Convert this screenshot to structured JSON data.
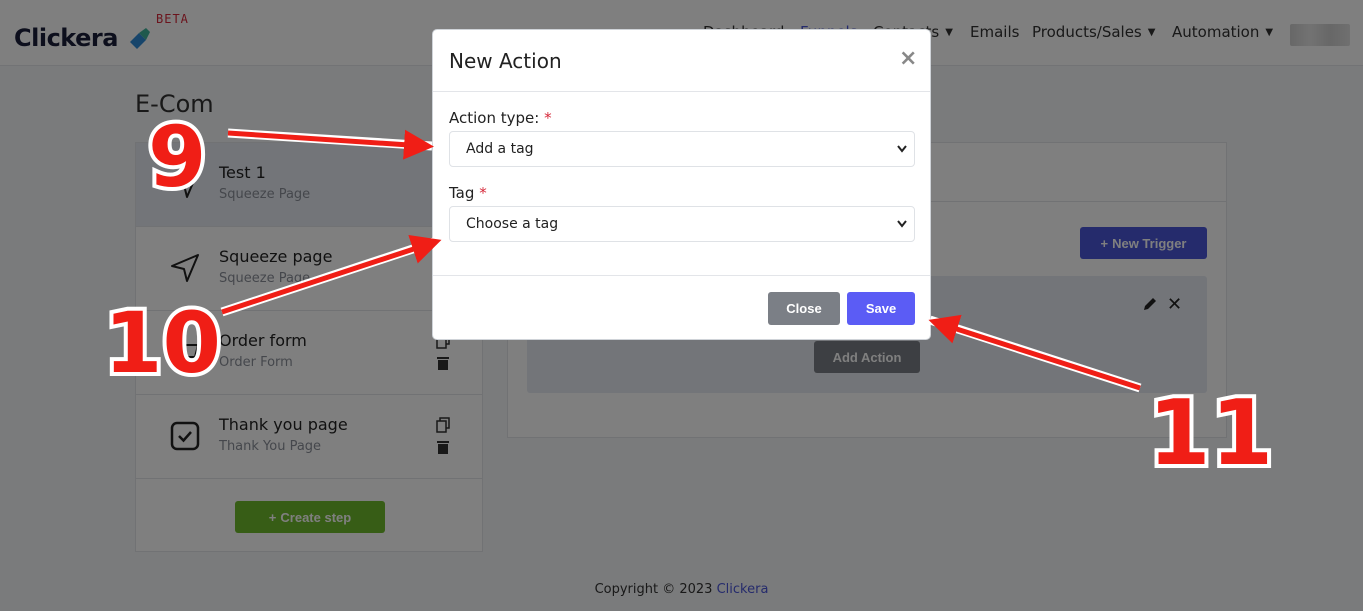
{
  "navbar": {
    "brand": "Clickera",
    "beta": "BETA",
    "items": [
      {
        "label": "Dashboard",
        "has_caret": false
      },
      {
        "label": "Funnels",
        "has_caret": false
      },
      {
        "label": "Contacts",
        "has_caret": true
      },
      {
        "label": "Emails",
        "has_caret": false
      },
      {
        "label": "Products/Sales",
        "has_caret": true
      },
      {
        "label": "Automation",
        "has_caret": true
      }
    ]
  },
  "page": {
    "title": "E-Com"
  },
  "steps": [
    {
      "name": "Test 1",
      "type": "Squeeze Page",
      "icon": "send-icon",
      "active": true
    },
    {
      "name": "Squeeze page",
      "type": "Squeeze Page",
      "icon": "send-icon",
      "active": false
    },
    {
      "name": "Order form",
      "type": "Order Form",
      "icon": "cart-icon",
      "active": false
    },
    {
      "name": "Thank you page",
      "type": "Thank You Page",
      "icon": "check-square-icon",
      "active": false
    }
  ],
  "create_step_label": "Create step",
  "right": {
    "new_trigger_label": "New Trigger",
    "add_action_label": "Add Action"
  },
  "footer": {
    "text": "Copyright © 2023 ",
    "link": "Clickera"
  },
  "modal": {
    "title": "New Action",
    "close_glyph": "×",
    "action_type_label": "Action type:",
    "action_type_value": "Add a tag",
    "tag_label": "Tag",
    "tag_value": "Choose a tag",
    "required_mark": "*",
    "close_label": "Close",
    "save_label": "Save"
  },
  "annotations": [
    "9",
    "10",
    "11"
  ],
  "colors": {
    "accent": "#4a56d8",
    "save": "#5b5cf5",
    "create": "#6fba2c",
    "annotation": "#f01e16"
  }
}
